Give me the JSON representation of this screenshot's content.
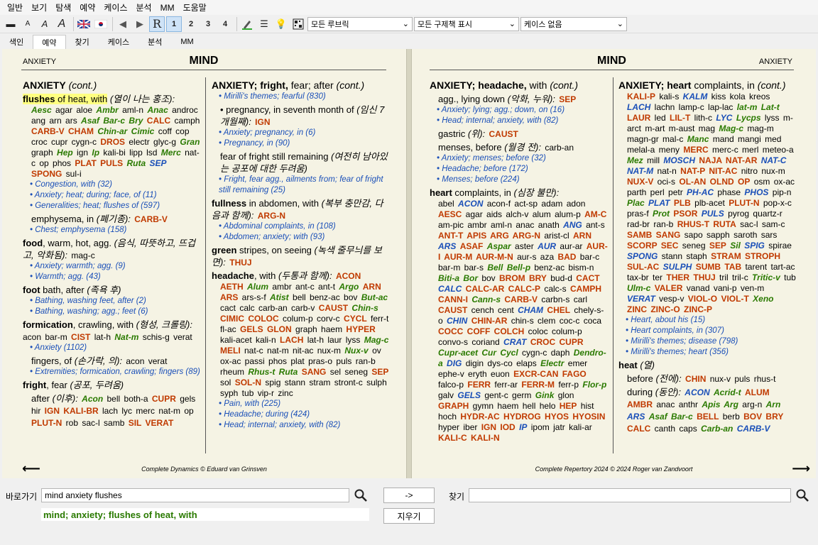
{
  "menu": [
    "일반",
    "보기",
    "탐색",
    "예약",
    "케이스",
    "분석",
    "MM",
    "도움말"
  ],
  "toolbar": {
    "r_label": "R",
    "b1": "1",
    "b2": "2",
    "b3": "3",
    "b4": "4",
    "dd_rubrics": "모든 루브릭",
    "dd_remedies": "모든 구제책 표시",
    "dd_cases": "케이스 없음"
  },
  "tabs": [
    "색인",
    "예약",
    "찾기",
    "케이스",
    "분석",
    "MM"
  ],
  "left_page": {
    "keyword": "ANXIETY",
    "title": "MIND",
    "footer": "Complete Dynamics © Eduard van Grinsven"
  },
  "right_page": {
    "keyword": "ANXIETY",
    "title": "MIND",
    "footer": "Complete Repertory 2024 © 2024 Roger van Zandvoort"
  },
  "col1": [
    {
      "t": "h",
      "txt": "ANXIETY",
      "it": " (cont.)"
    },
    {
      "t": "s",
      "hl": "flushes",
      "txt": " of heat, with",
      "kr": " (열이 나는 홍조):"
    },
    {
      "t": "m",
      "html": "<span class='r2i'>Aesc</span> agar aloe <span class='r2i'>Ambr</span> aml-n <span class='r2i'>Anac</span> androc ang arn ars <span class='r2i'>Asaf Bar-c</span> <span class='r2i'>Bry</span> <span class='r3'>CALC</span> camph <span class='r3'>CARB-V CHAM</span> <span class='r2i'>Chin-ar Cimic</span> coff cop croc cupr cygn-c <span class='r3'>DROS</span> electr glyc-g <span class='r2i'>Gran</span> graph <span class='r2i'>Hep</span> ign <span class='r2i'>Ip</span> kali-bi lipp lsd <span class='r2i'>Merc</span> nat-c op phos <span class='r3'>PLAT PULS</span> <span class='r2i'>Ruta</span> <span class='r2b'>SEP</span> <span class='r3'>SPONG</span> sul-i"
    },
    {
      "t": "x",
      "txt": "Congestion, with (32)"
    },
    {
      "t": "x",
      "txt": "Anxiety; heat; during; face, of (11)"
    },
    {
      "t": "x",
      "txt": "Generalities; heat; flushes of (597)"
    },
    {
      "t": "s",
      "ind": 1,
      "txt": "emphysema, in",
      "kr": " (폐기종):",
      "after": " <span class='r3'>CARB-V</span>"
    },
    {
      "t": "x",
      "txt": "Chest; emphysema (158)"
    },
    {
      "t": "s",
      "b": "food",
      "txt": ", warm, hot, agg.",
      "kr": " (음식, 따뜻하고, 뜨겁고, 악화됨):",
      "after": " mag-c"
    },
    {
      "t": "x",
      "txt": "Anxiety; warmth; agg. (9)"
    },
    {
      "t": "x",
      "txt": "Warmth; agg. (43)"
    },
    {
      "t": "s",
      "b": "foot",
      "txt": " bath, after",
      "kr": " (족욕 후)"
    },
    {
      "t": "x",
      "txt": "Bathing, washing feet, after (2)"
    },
    {
      "t": "x",
      "txt": "Bathing, washing; agg.; feet (6)"
    },
    {
      "t": "s",
      "b": "formication",
      "txt": ", crawling, with",
      "kr": " (형성, 크롤링):",
      "after": " acon bar-m <span class='r3'>CIST</span> lat-h <span class='r2i'>Nat-m</span> schis-g verat"
    },
    {
      "t": "x",
      "txt": "Anxiety (1102)"
    },
    {
      "t": "s",
      "ind": 1,
      "txt": "fingers, of",
      "kr": " (손가락, 의):",
      "after": " acon verat"
    },
    {
      "t": "x",
      "txt": "Extremities; formication, crawling; fingers (89)"
    },
    {
      "t": "s",
      "b": "fright",
      "txt": ", fear",
      "kr": " (공포, 두려움)"
    },
    {
      "t": "s",
      "ind": 1,
      "txt": "after",
      "kr": " (이후):",
      "after": " <span class='r2i'>Acon</span> bell both-a <span class='r3'>CUPR</span> gels hir <span class='r3'>IGN KALI-BR</span> lach lyc merc nat-m op <span class='r3'>PLUT-N</span> rob sac-l samb <span class='r3'>SIL VERAT</span>"
    }
  ],
  "col2": [
    {
      "t": "h",
      "txt": "ANXIETY; fright,",
      "plain": " fear; after",
      "it": " (cont.)"
    },
    {
      "t": "x",
      "txt": "Mirilli's themes; fearful (830)"
    },
    {
      "t": "s",
      "ind": 1,
      "txt": "• pregnancy, in seventh month of",
      "kr": " (임신 7개월째):",
      "after": " <span class='r3'>IGN</span>"
    },
    {
      "t": "x",
      "txt": "Anxiety; pregnancy, in (6)"
    },
    {
      "t": "x",
      "txt": "Pregnancy, in (90)"
    },
    {
      "t": "s",
      "ind": 1,
      "txt": "fear of fright still remaining",
      "kr": " (여전히 남아있는 공포에 대한 두려움)"
    },
    {
      "t": "x",
      "txt": "Fright, fear agg., ailments from; fear of fright still remaining (25)"
    },
    {
      "t": "s",
      "b": "fullness",
      "txt": " in abdomen, with",
      "kr": " (복부 충만감, 다음과 함께):",
      "after": " <span class='r3'>ARG-N</span>"
    },
    {
      "t": "x",
      "txt": "Abdominal complaints, in (108)"
    },
    {
      "t": "x",
      "txt": "Abdomen; anxiety; with (93)"
    },
    {
      "t": "s",
      "b": "green",
      "txt": " stripes, on seeing",
      "kr": " (녹색 줄무늬를 보면):",
      "after": " <span class='r3'>THUJ</span>"
    },
    {
      "t": "s",
      "b": "headache",
      "txt": ", with",
      "kr": " (두통과 함께):",
      "after": " <span class='r3'>ACON</span>"
    },
    {
      "t": "m",
      "html": "<span class='r3'>AETH</span> <span class='r2i'>Alum</span> ambr ant-c ant-t <span class='r2i'>Argo</span> <span class='r3'>ARN ARS</span> ars-s-f <span class='r2i'>Atist</span> bell benz-ac bov <span class='r2i'>But-ac</span> cact calc carb-an carb-v <span class='r3'>CAUST</span> <span class='r2i'>Chin-s</span> <span class='r3'>CIMIC COLOC</span> colum-p corv-c <span class='r3'>CYCL</span> ferr-t fl-ac <span class='r3'>GELS GLON</span> graph haem <span class='r3'>HYPER</span> kali-acet kali-n <span class='r3'>LACH</span> lat-h laur lyss <span class='r2i'>Mag-c</span> <span class='r3'>MELI</span> nat-c nat-m nit-ac nux-m <span class='r2i'>Nux-v</span> ov ox-ac passi phos plat pras-o puls ran-b rheum <span class='r2i'>Rhus-t Ruta</span> <span class='r3'>SANG</span> sel seneg <span class='r3'>SEP</span> sol <span class='r3'>SOL-N</span> spig stann stram stront-c sulph syph tub vip-r zinc"
    },
    {
      "t": "x",
      "txt": "Pain, with (225)"
    },
    {
      "t": "x",
      "txt": "Headache; during (424)"
    },
    {
      "t": "x",
      "txt": "Head; internal; anxiety, with (82)"
    }
  ],
  "col3": [
    {
      "t": "h",
      "txt": "ANXIETY; headache,",
      "plain": " with",
      "it": " (cont.)"
    },
    {
      "t": "s",
      "ind": 1,
      "txt": "agg., lying down",
      "kr": " (악화, 누워):",
      "after": " <span class='r3'>SEP</span>"
    },
    {
      "t": "x",
      "txt": "Anxiety; lying; agg.; down, on (16)"
    },
    {
      "t": "x",
      "txt": "Head; internal; anxiety, with (82)"
    },
    {
      "t": "s",
      "ind": 1,
      "txt": "gastric",
      "kr": " (위):",
      "after": " <span class='r3'>CAUST</span>"
    },
    {
      "t": "s",
      "ind": 1,
      "txt": "menses, before",
      "kr": " (월경 전):",
      "after": " carb-an"
    },
    {
      "t": "x",
      "txt": "Anxiety; menses; before (32)"
    },
    {
      "t": "x",
      "txt": "Headache; before (172)"
    },
    {
      "t": "x",
      "txt": "Menses; before (224)"
    },
    {
      "t": "s",
      "b": "heart",
      "txt": " complaints, in",
      "kr": " (심장 불만):"
    },
    {
      "t": "m",
      "html": "abel <span class='r2b'>ACON</span> acon-f act-sp adam adon <span class='r3'>AESC</span> agar aids alch-v alum alum-p <span class='r3'>AM-C</span> am-pic ambr aml-n anac anath <span class='r2b'>ANG</span> ant-s <span class='r3'>ANT-T APIS ARG ARG-N</span> arist-cl <span class='r3'>ARN</span> <span class='r2b'>ARS</span> <span class='r3'>ASAF</span> <span class='r2i'>Aspar</span> aster <span class='r2b'>AUR</span> aur-ar <span class='r3'>AUR-I AUR-M AUR-M-N</span> aur-s aza <span class='r3'>BAD</span> bar-c bar-m bar-s <span class='r2i'>Bell</span> <span class='r2i'>Bell-p</span> benz-ac bism-n <span class='r2i'>Biti-a Bor</span> bov <span class='r3'>BROM BRY</span> bud-d <span class='r3'>CACT</span> <span class='r2b'>CALC</span> <span class='r3'>CALC-AR CALC-P</span> calc-s <span class='r3'>CAMPH</span> <span class='r3'>CANN-I</span> <span class='r2i'>Cann-s</span> <span class='r3'>CARB-V</span> carbn-s carl <span class='r3'>CAUST</span> cench cent <span class='r2b'>CHAM</span> <span class='r3'>CHEL</span> chely-s-o <span class='r2b'>CHIN</span> <span class='r3'>CHIN-AR</span> chin-s clem coc-c coca <span class='r3'>COCC COFF COLCH</span> coloc colum-p convo-s coriand <span class='r2b'>CRAT</span> <span class='r3'>CROC</span> <span class='r3'>CUPR</span> <span class='r2i'>Cupr-acet Cur Cycl</span> cygn-c daph <span class='r2i'>Dendro-a</span> <span class='r2b'>DIG</span> digin dys-co elaps <span class='r2i'>Electr</span> emer ephe-v eryth euon <span class='r3'>EXCR-CAN FAGO</span> falco-p <span class='r3'>FERR</span> ferr-ar <span class='r3'>FERR-M</span> ferr-p <span class='r2i'>Flor-p</span> galv <span class='r2b'>GELS</span> gent-c germ <span class='r2i'>Gink</span> glon <span class='r3'>GRAPH</span> gymn haem hell helo <span class='r3'>HEP</span> hist hoch <span class='r3'>HYDR-AC</span> <span class='r3'>HYDROG HYOS HYOSIN</span> hyper iber <span class='r3'>IGN</span> <span class='r3'>IOD</span> <span class='r2b'>IP</span> ipom jatr kali-ar <span class='r3'>KALI-C KALI-N</span>"
    }
  ],
  "col4": [
    {
      "t": "h",
      "txt": "ANXIETY; heart",
      "plain": " complaints, in",
      "it": " (cont.)"
    },
    {
      "t": "m",
      "html": "<span class='r3'>KALI-P</span> kali-s <span class='r2b'>KALM</span> kiss kola kreos <span class='r2b'>LACH</span> lachn lamp-c lap-lac <span class='r2i'>lat-m Lat-t</span> <span class='r3'>LAUR</span> led <span class='r3'>LIL-T</span> lith-c <span class='r2b'>LYC</span> <span class='r2i'>Lycps</span> lyss m-arct m-art m-aust mag <span class='r2i'>Mag-c</span> mag-m magn-gr mal-c <span class='r2i'>Manc</span> mand mangi med melal-a meny <span class='r3'>MERC</span> merc-c merl meteo-a <span class='r2i'>Mez</span> mill <span class='r2b'>MOSCH</span> <span class='r3'>NAJA NAT-AR</span> <span class='r2b'>NAT-C NAT-M</span> nat-n <span class='r3'>NAT-P NIT-AC</span> nitro nux-m <span class='r3'>NUX-V</span> oci-s <span class='r3'>OL-AN OLND OP</span> osm ox-ac parth perl petr <span class='r2b'>PH-AC</span> phase <span class='r2b'>PHOS</span> pip-n <span class='r2i'>Plac</span> <span class='r2b'>PLAT</span> <span class='r3'>PLB</span> plb-acet <span class='r3'>PLUT-N</span> pop-x-c pras-f <span class='r2i'>Prot</span> <span class='r3'>PSOR</span> <span class='r2b'>PULS</span> pyrog quartz-r rad-br ran-b <span class='r3'>RHUS-T RUTA</span> sac-l sam-c <span class='r3'>SAMB SANG</span> sapo sapph saroth sars <span class='r3'>SCORP SEC</span> seneg <span class='r3'>SEP</span> <span class='r2i'>Sil</span> <span class='r2b'>SPIG</span> spirae <span class='r2b'>SPONG</span> stann staph <span class='r3'>STRAM STROPH SUL-AC</span> <span class='r2b'>SULPH</span> <span class='r3'>SUMB TAB</span> tarent tart-ac tax-br ter <span class='r3'>THER THUJ</span> tril tril-c <span class='r2i'>Tritic-v</span> tub <span class='r2i'>Ulm-c</span> <span class='r3'>VALER</span> vanad vani-p ven-m <span class='r2b'>VERAT</span> vesp-v <span class='r3'>VIOL-O VIOL-T</span> <span class='r2i'>Xeno</span> <span class='r3'>ZINC ZINC-O ZINC-P</span>"
    },
    {
      "t": "x",
      "txt": "Heart, about his (15)"
    },
    {
      "t": "x",
      "txt": "Heart complaints, in (307)"
    },
    {
      "t": "x",
      "txt": "Mirilli's themes; disease (798)"
    },
    {
      "t": "x",
      "txt": "Mirilli's themes; heart (356)"
    },
    {
      "t": "s",
      "b": "heat",
      "txt": "",
      "kr": " (열)"
    },
    {
      "t": "s",
      "ind": 1,
      "txt": "before",
      "kr": " (전에):",
      "after": " <span class='r3'>CHIN</span> nux-v puls rhus-t"
    },
    {
      "t": "s",
      "ind": 1,
      "txt": "during",
      "kr": " (동안):",
      "after": " <span class='r2b'>ACON</span> <span class='r2i'>Acrid-t</span> <span class='r3'>ALUM</span> <span class='r3'>AMBR</span> anac anthr <span class='r2i'>Apis Arg</span> arg-n <span class='r2i'>Arn</span> <span class='r2b'>ARS</span> <span class='r2i'>Asaf Bar-c</span> <span class='r3'>BELL</span> berb <span class='r3'>BOV BRY</span> <span class='r3'>CALC</span> canth caps <span class='r2i'>Carb-an</span> <span class='r2b'>CARB-V</span>"
    }
  ],
  "bottom": {
    "goto_label": "바로가기",
    "goto_value": "mind anxiety flushes",
    "go_button": "->",
    "clear_button": "지우기",
    "find_label": "찾기",
    "find_value": "",
    "result": "mind; anxiety; flushes of heat, with"
  }
}
